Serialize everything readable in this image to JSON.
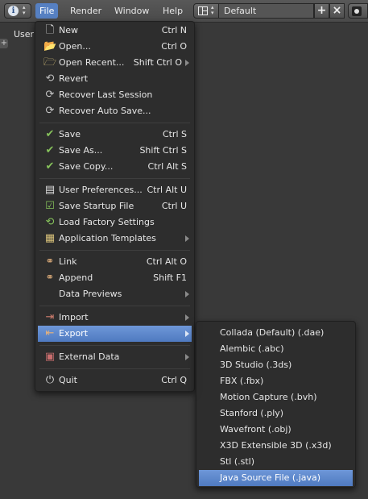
{
  "header": {
    "info_icon": "info-icon",
    "menus": [
      {
        "label": "File",
        "active": true
      },
      {
        "label": "Render",
        "active": false
      },
      {
        "label": "Window",
        "active": false
      },
      {
        "label": "Help",
        "active": false
      }
    ],
    "screen_layout": "Default",
    "add_symbol": "+",
    "remove_symbol": "×"
  },
  "viewport": {
    "label": "User",
    "tab_symbol": "+"
  },
  "file_menu": {
    "items": [
      {
        "label": "New",
        "shortcut": "Ctrl N",
        "icon": "new-file-icon"
      },
      {
        "label": "Open...",
        "shortcut": "Ctrl O",
        "icon": "folder-open-icon"
      },
      {
        "label": "Open Recent...",
        "shortcut": "Shift Ctrl O",
        "icon": "open-recent-icon",
        "submenu": true
      },
      {
        "label": "Revert",
        "shortcut": "",
        "icon": "revert-icon"
      },
      {
        "label": "Recover Last Session",
        "shortcut": "",
        "icon": "recover-icon"
      },
      {
        "label": "Recover Auto Save...",
        "shortcut": "",
        "icon": "recover-icon"
      },
      {
        "label": "Save",
        "shortcut": "Ctrl S",
        "icon": "checkmark-icon"
      },
      {
        "label": "Save As...",
        "shortcut": "Shift Ctrl S",
        "icon": "checkmark-icon"
      },
      {
        "label": "Save Copy...",
        "shortcut": "Ctrl Alt S",
        "icon": "checkmark-icon"
      },
      {
        "label": "User Preferences...",
        "shortcut": "Ctrl Alt U",
        "icon": "preferences-icon"
      },
      {
        "label": "Save Startup File",
        "shortcut": "Ctrl U",
        "icon": "save-startup-icon"
      },
      {
        "label": "Load Factory Settings",
        "shortcut": "",
        "icon": "load-factory-icon"
      },
      {
        "label": "Application Templates",
        "shortcut": "",
        "icon": "templates-icon",
        "submenu": true
      },
      {
        "label": "Link",
        "shortcut": "Ctrl Alt O",
        "icon": "link-icon"
      },
      {
        "label": "Append",
        "shortcut": "Shift F1",
        "icon": "append-icon"
      },
      {
        "label": "Data Previews",
        "shortcut": "",
        "icon": "",
        "submenu": true
      },
      {
        "label": "Import",
        "shortcut": "",
        "icon": "import-icon",
        "submenu": true
      },
      {
        "label": "Export",
        "shortcut": "",
        "icon": "export-icon",
        "submenu": true,
        "highlighted": true
      },
      {
        "label": "External Data",
        "shortcut": "",
        "icon": "external-data-icon",
        "submenu": true
      },
      {
        "label": "Quit",
        "shortcut": "Ctrl Q",
        "icon": "power-icon"
      }
    ]
  },
  "export_menu": {
    "items": [
      {
        "label": "Collada (Default) (.dae)"
      },
      {
        "label": "Alembic (.abc)"
      },
      {
        "label": "3D Studio (.3ds)"
      },
      {
        "label": "FBX (.fbx)"
      },
      {
        "label": "Motion Capture (.bvh)"
      },
      {
        "label": "Stanford (.ply)"
      },
      {
        "label": "Wavefront (.obj)"
      },
      {
        "label": "X3D Extensible 3D (.x3d)"
      },
      {
        "label": "Stl (.stl)"
      },
      {
        "label": "Java Source File (.java)",
        "highlighted": true
      }
    ]
  },
  "colors": {
    "background": "#393939",
    "menu_bg": "#2c2c2c",
    "highlight": "#5680c2",
    "text": "#e6e6e6"
  }
}
